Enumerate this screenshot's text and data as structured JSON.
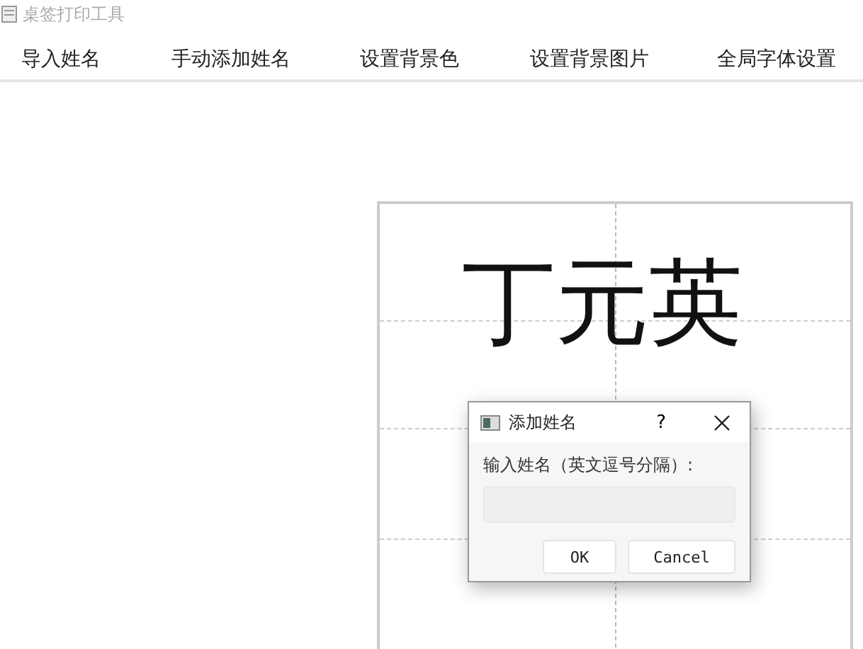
{
  "window": {
    "title": "桌签打印工具"
  },
  "menu": [
    "导入姓名",
    "手动添加姓名",
    "设置背景色",
    "设置背景图片",
    "全局字体设置"
  ],
  "card": {
    "names": [
      "丁元英"
    ]
  },
  "dialog": {
    "title": "添加姓名",
    "help": "?",
    "prompt": "输入姓名（英文逗号分隔）:",
    "buttons": [
      "OK",
      "Cancel"
    ]
  }
}
